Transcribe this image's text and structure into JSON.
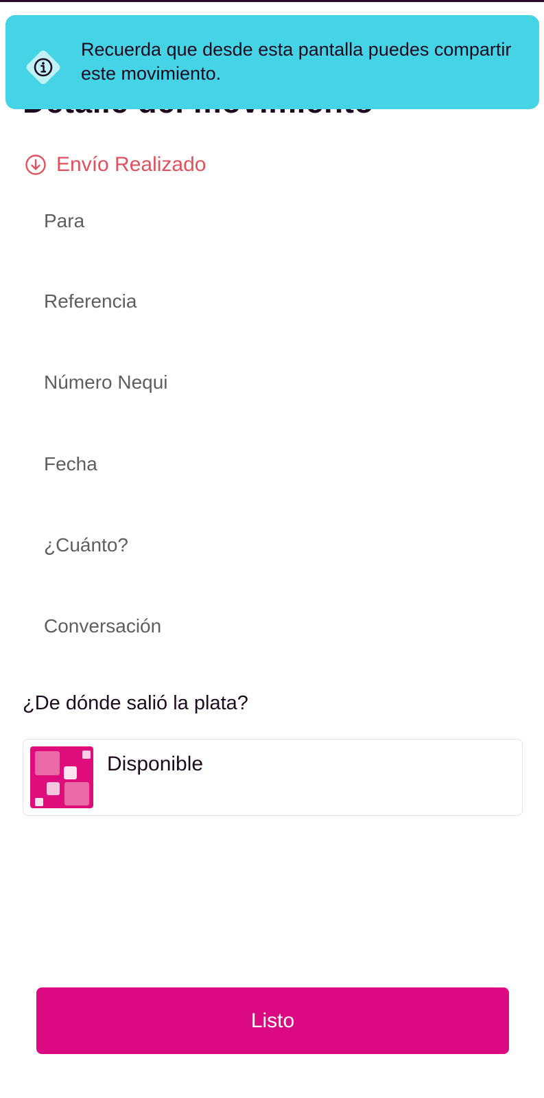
{
  "header": {
    "title": "Detalle del movimiento"
  },
  "toast": {
    "icon": "info-icon",
    "message": "Recuerda que desde esta pantalla puedes compartir este movimiento.",
    "background": "#45d4e6"
  },
  "status": {
    "icon": "arrow-down-circle-icon",
    "label": "Envío Realizado",
    "color": "#e2505c"
  },
  "details": {
    "fields": [
      {
        "label": "Para"
      },
      {
        "label": "Referencia"
      },
      {
        "label": "Número Nequi"
      },
      {
        "label": "Fecha"
      },
      {
        "label": "¿Cuánto?"
      },
      {
        "label": "Conversación"
      }
    ]
  },
  "source": {
    "question": "¿De dónde salió la plata?",
    "account_name": "Disponible",
    "logo_icon": "disponible-logo",
    "brand_color": "#df0c7c"
  },
  "actions": {
    "done_label": "Listo",
    "button_color": "#dc0a82"
  }
}
